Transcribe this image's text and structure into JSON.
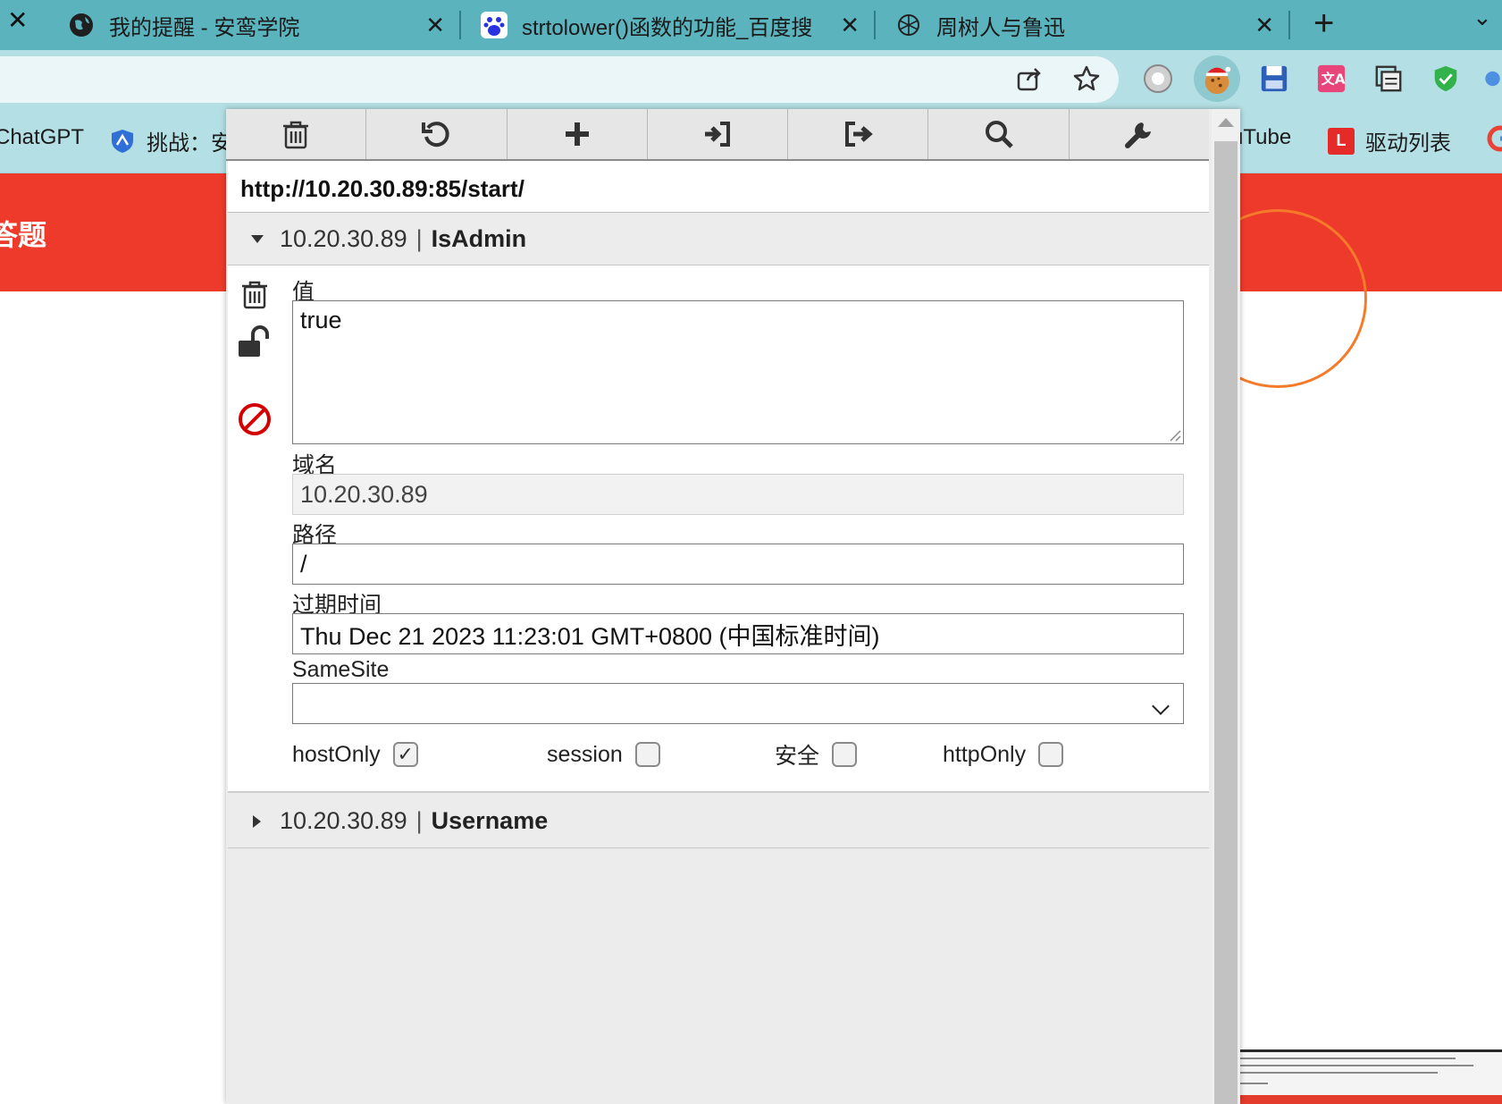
{
  "tabs": [
    {
      "title": "我的提醒 - 安鸾学院",
      "icon": "globe-icon"
    },
    {
      "title": "strtolower()函数的功能_百度搜",
      "icon": "baidu-paw-icon"
    },
    {
      "title": "周树人与鲁迅",
      "icon": "chatgpt-icon"
    }
  ],
  "bookmarks": [
    {
      "label": "ChatGPT",
      "icon": "chatgpt-icon"
    },
    {
      "label": "挑战：安",
      "icon": "shield-icon"
    },
    {
      "label": "uTube",
      "icon": "youtube-icon"
    },
    {
      "label": "驱动列表",
      "icon": "l-logo-icon"
    },
    {
      "label": "",
      "icon": "google-icon"
    }
  ],
  "page_behind": {
    "banner_text": "答题"
  },
  "cookie_editor": {
    "url": "http://10.20.30.89:85/start/",
    "cookies": [
      {
        "domain": "10.20.30.89",
        "separator": "|",
        "name": "IsAdmin",
        "expanded": true
      },
      {
        "domain": "10.20.30.89",
        "separator": "|",
        "name": "Username",
        "expanded": false
      }
    ],
    "detail": {
      "value_label": "值",
      "value": "true",
      "domain_label": "域名",
      "domain_value": "10.20.30.89",
      "path_label": "路径",
      "path_value": "/",
      "expires_label": "过期时间",
      "expires_value": "Thu Dec 21 2023 11:23:01 GMT+0800 (中国标准时间)",
      "samesite_label": "SameSite",
      "samesite_value": "",
      "flags": [
        {
          "label": "hostOnly",
          "checked": true
        },
        {
          "label": "session",
          "checked": false
        },
        {
          "label": "安全",
          "checked": false
        },
        {
          "label": "httpOnly",
          "checked": false
        }
      ]
    },
    "toolbar_icons": [
      "delete-all-icon",
      "refresh-icon",
      "add-icon",
      "import-icon",
      "export-icon",
      "search-icon",
      "settings-wrench-icon"
    ],
    "detail_icons": [
      "trash-icon",
      "unlock-icon",
      "block-icon"
    ]
  },
  "colors": {
    "tabbar": "#5ab3bd",
    "toolbar": "#b4dfe4",
    "banner": "#ee3a2b"
  }
}
